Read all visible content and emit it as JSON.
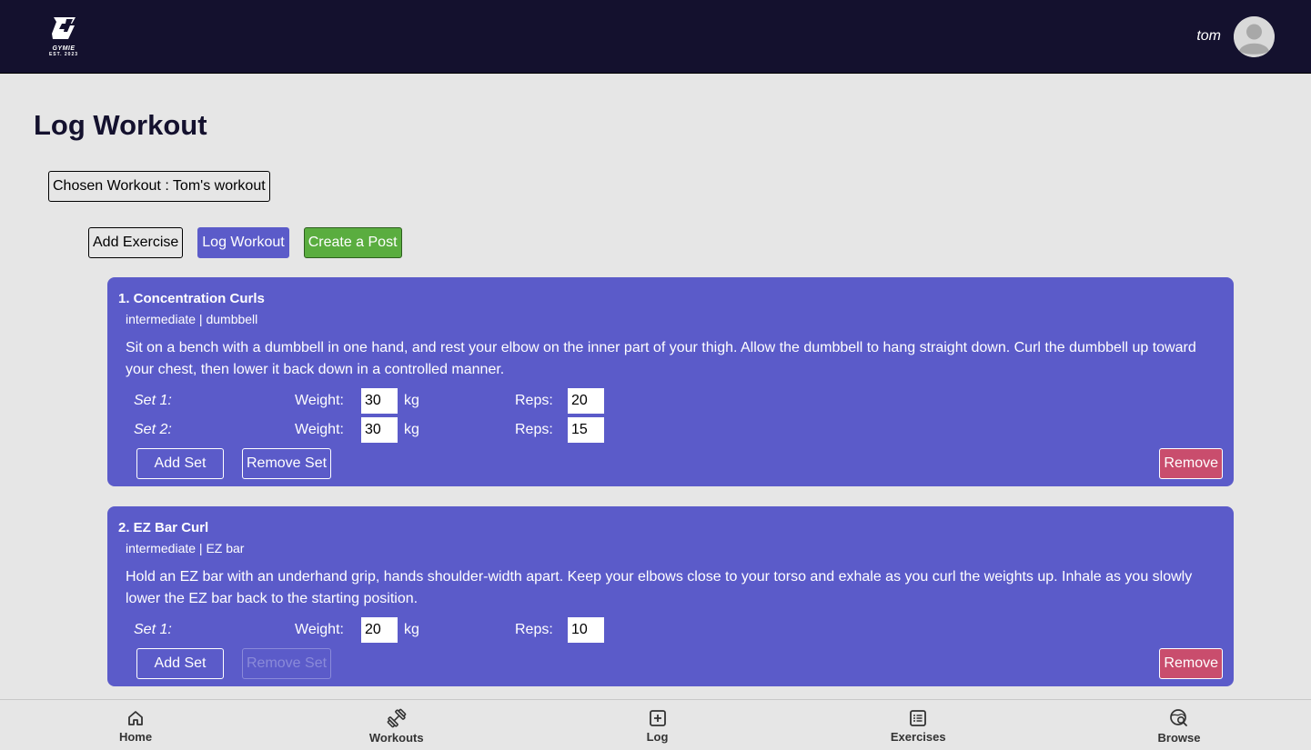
{
  "header": {
    "logo_name": "GYMIE",
    "logo_est": "EST. 2023",
    "username": "tom"
  },
  "page": {
    "title": "Log Workout",
    "chosen_workout": "Chosen Workout : Tom's workout"
  },
  "actions": {
    "add_exercise": "Add Exercise",
    "log_workout": "Log Workout",
    "create_post": "Create a Post"
  },
  "labels": {
    "weight": "Weight:",
    "unit": "kg",
    "reps": "Reps:",
    "add_set": "Add Set",
    "remove_set": "Remove Set",
    "remove": "Remove"
  },
  "exercises": [
    {
      "title": "1. Concentration Curls",
      "meta": "intermediate | dumbbell",
      "description": "Sit on a bench with a dumbbell in one hand, and rest your elbow on the inner part of your thigh. Allow the dumbbell to hang straight down. Curl the dumbbell up toward your chest, then lower it back down in a controlled manner.",
      "sets": [
        {
          "label": "Set 1:",
          "weight": "30",
          "reps": "20"
        },
        {
          "label": "Set 2:",
          "weight": "30",
          "reps": "15"
        }
      ]
    },
    {
      "title": "2. EZ Bar Curl",
      "meta": "intermediate | EZ bar",
      "description": "Hold an EZ bar with an underhand grip, hands shoulder-width apart. Keep your elbows close to your torso and exhale as you curl the weights up. Inhale as you slowly lower the EZ bar back to the starting position.",
      "sets": [
        {
          "label": "Set 1:",
          "weight": "20",
          "reps": "10"
        }
      ]
    }
  ],
  "bottom_nav": [
    {
      "label": "Home",
      "icon": "home-icon"
    },
    {
      "label": "Workouts",
      "icon": "dumbbell-icon"
    },
    {
      "label": "Log",
      "icon": "plus-square-icon"
    },
    {
      "label": "Exercises",
      "icon": "list-icon"
    },
    {
      "label": "Browse",
      "icon": "search-globe-icon"
    }
  ],
  "colors": {
    "header_bg": "#14112e",
    "page_bg": "#e6e6e6",
    "card_bg": "#5b5bc9",
    "accent_green": "#5aad3f",
    "remove_red": "#c94d6d"
  }
}
